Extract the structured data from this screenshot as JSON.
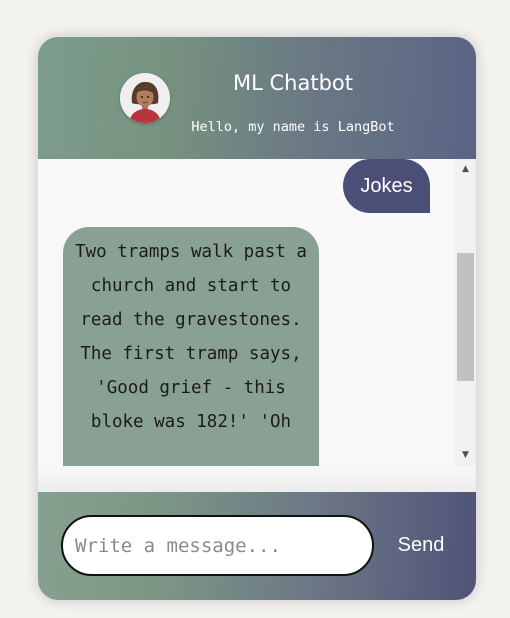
{
  "header": {
    "title": "ML Chatbot",
    "subtitle": "Hello, my name is LangBot",
    "avatar_icon": "female-avatar-icon"
  },
  "messages": [
    {
      "sender": "user",
      "text": "Jokes"
    },
    {
      "sender": "bot",
      "text": "Two tramps walk past a church and start to read the gravestones. The first tramp says, 'Good grief - this bloke was 182!' 'Oh"
    }
  ],
  "footer": {
    "input_placeholder": "Write a message...",
    "input_value": "",
    "send_label": "Send"
  },
  "colors": {
    "header_gradient_start": "#7d9d8c",
    "header_gradient_end": "#5b6385",
    "user_bubble": "#4b4f78",
    "bot_bubble": "#89a192"
  }
}
